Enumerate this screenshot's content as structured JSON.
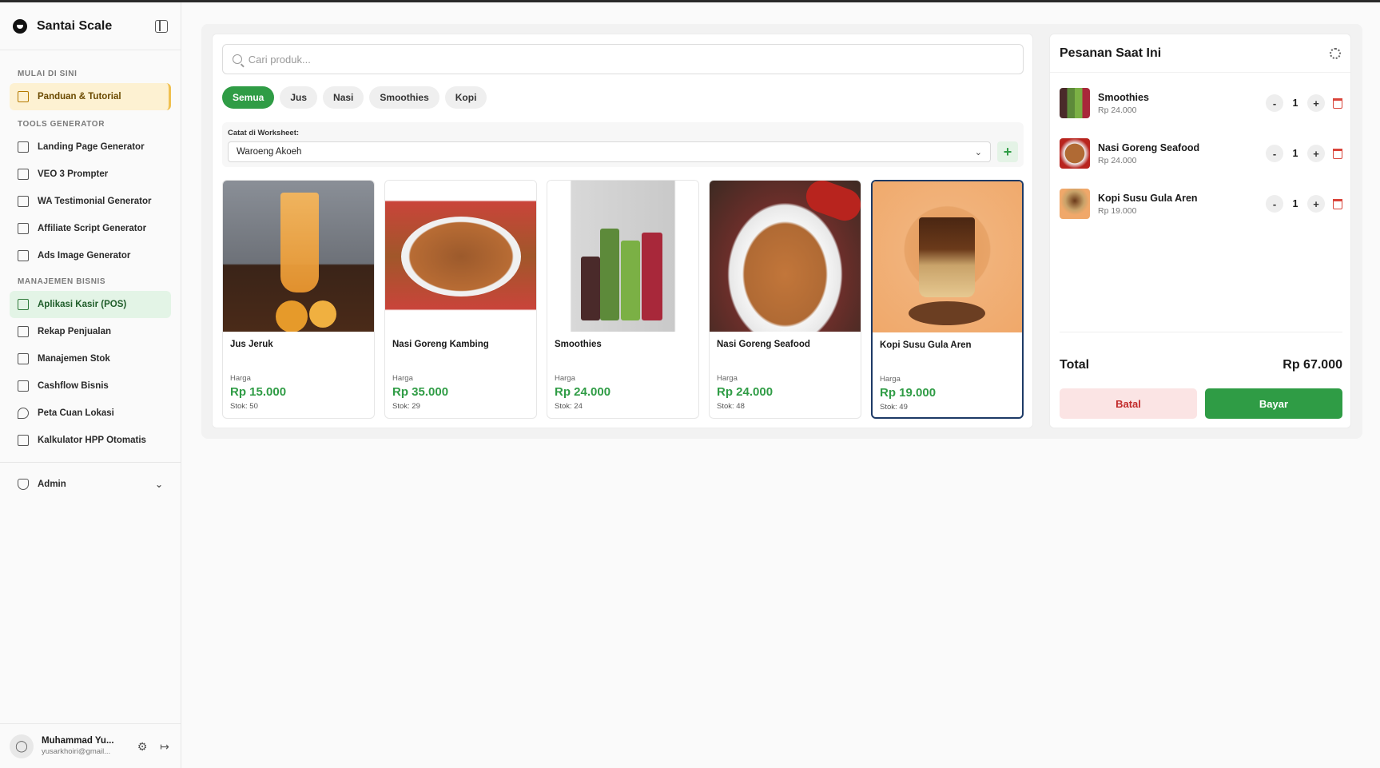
{
  "app": {
    "name": "Santai Scale"
  },
  "sidebar": {
    "sections": [
      {
        "title": "MULAI DI SINI"
      },
      {
        "title": "TOOLS GENERATOR"
      },
      {
        "title": "MANAJEMEN BISNIS"
      }
    ],
    "items": [
      {
        "label": "Panduan & Tutorial",
        "icon": "book-icon"
      },
      {
        "label": "Landing Page Generator",
        "icon": "layout-icon"
      },
      {
        "label": "VEO 3 Prompter",
        "icon": "film-icon"
      },
      {
        "label": "WA Testimonial Generator",
        "icon": "message-icon"
      },
      {
        "label": "Affiliate Script Generator",
        "icon": "script-icon"
      },
      {
        "label": "Ads Image Generator",
        "icon": "image-icon"
      },
      {
        "label": "Aplikasi Kasir (POS)",
        "icon": "cart-icon"
      },
      {
        "label": "Rekap Penjualan",
        "icon": "copy-icon"
      },
      {
        "label": "Manajemen Stok",
        "icon": "warehouse-icon"
      },
      {
        "label": "Cashflow Bisnis",
        "icon": "bank-icon"
      },
      {
        "label": "Peta Cuan Lokasi",
        "icon": "map-pin-icon"
      },
      {
        "label": "Kalkulator HPP Otomatis",
        "icon": "calculator-icon"
      }
    ],
    "admin": {
      "label": "Admin"
    },
    "user": {
      "name": "Muhammad Yu...",
      "email": "yusarkhoiri@gmail..."
    }
  },
  "pos": {
    "search": {
      "placeholder": "Cari produk...",
      "value": ""
    },
    "categories": [
      "Semua",
      "Jus",
      "Nasi",
      "Smoothies",
      "Kopi"
    ],
    "active_category": "Semua",
    "worksheet": {
      "label": "Catat di Worksheet:",
      "value": "Waroeng Akoeh"
    },
    "products": [
      {
        "name": "Jus Jeruk",
        "price_label": "Harga",
        "price": "Rp 15.000",
        "stock": "Stok: 50"
      },
      {
        "name": "Nasi Goreng Kambing",
        "price_label": "Harga",
        "price": "Rp 35.000",
        "stock": "Stok: 29"
      },
      {
        "name": "Smoothies",
        "price_label": "Harga",
        "price": "Rp 24.000",
        "stock": "Stok: 24"
      },
      {
        "name": "Nasi Goreng Seafood",
        "price_label": "Harga",
        "price": "Rp 24.000",
        "stock": "Stok: 48"
      },
      {
        "name": "Kopi Susu Gula Aren",
        "price_label": "Harga",
        "price": "Rp 19.000",
        "stock": "Stok: 49"
      }
    ],
    "selected_product": "Kopi Susu Gula Aren"
  },
  "order": {
    "title": "Pesanan Saat Ini",
    "items": [
      {
        "name": "Smoothies",
        "price": "Rp 24.000",
        "qty": "1"
      },
      {
        "name": "Nasi Goreng Seafood",
        "price": "Rp 24.000",
        "qty": "1"
      },
      {
        "name": "Kopi Susu Gula Aren",
        "price": "Rp 19.000",
        "qty": "1"
      }
    ],
    "total_label": "Total",
    "total_value": "Rp 67.000",
    "cancel_label": "Batal",
    "pay_label": "Bayar",
    "minus": "-",
    "plus": "+"
  },
  "colors": {
    "accent_green": "#2f9c45",
    "highlight_yellow": "#fdf1d2",
    "cancel_red": "#c22b2b"
  }
}
